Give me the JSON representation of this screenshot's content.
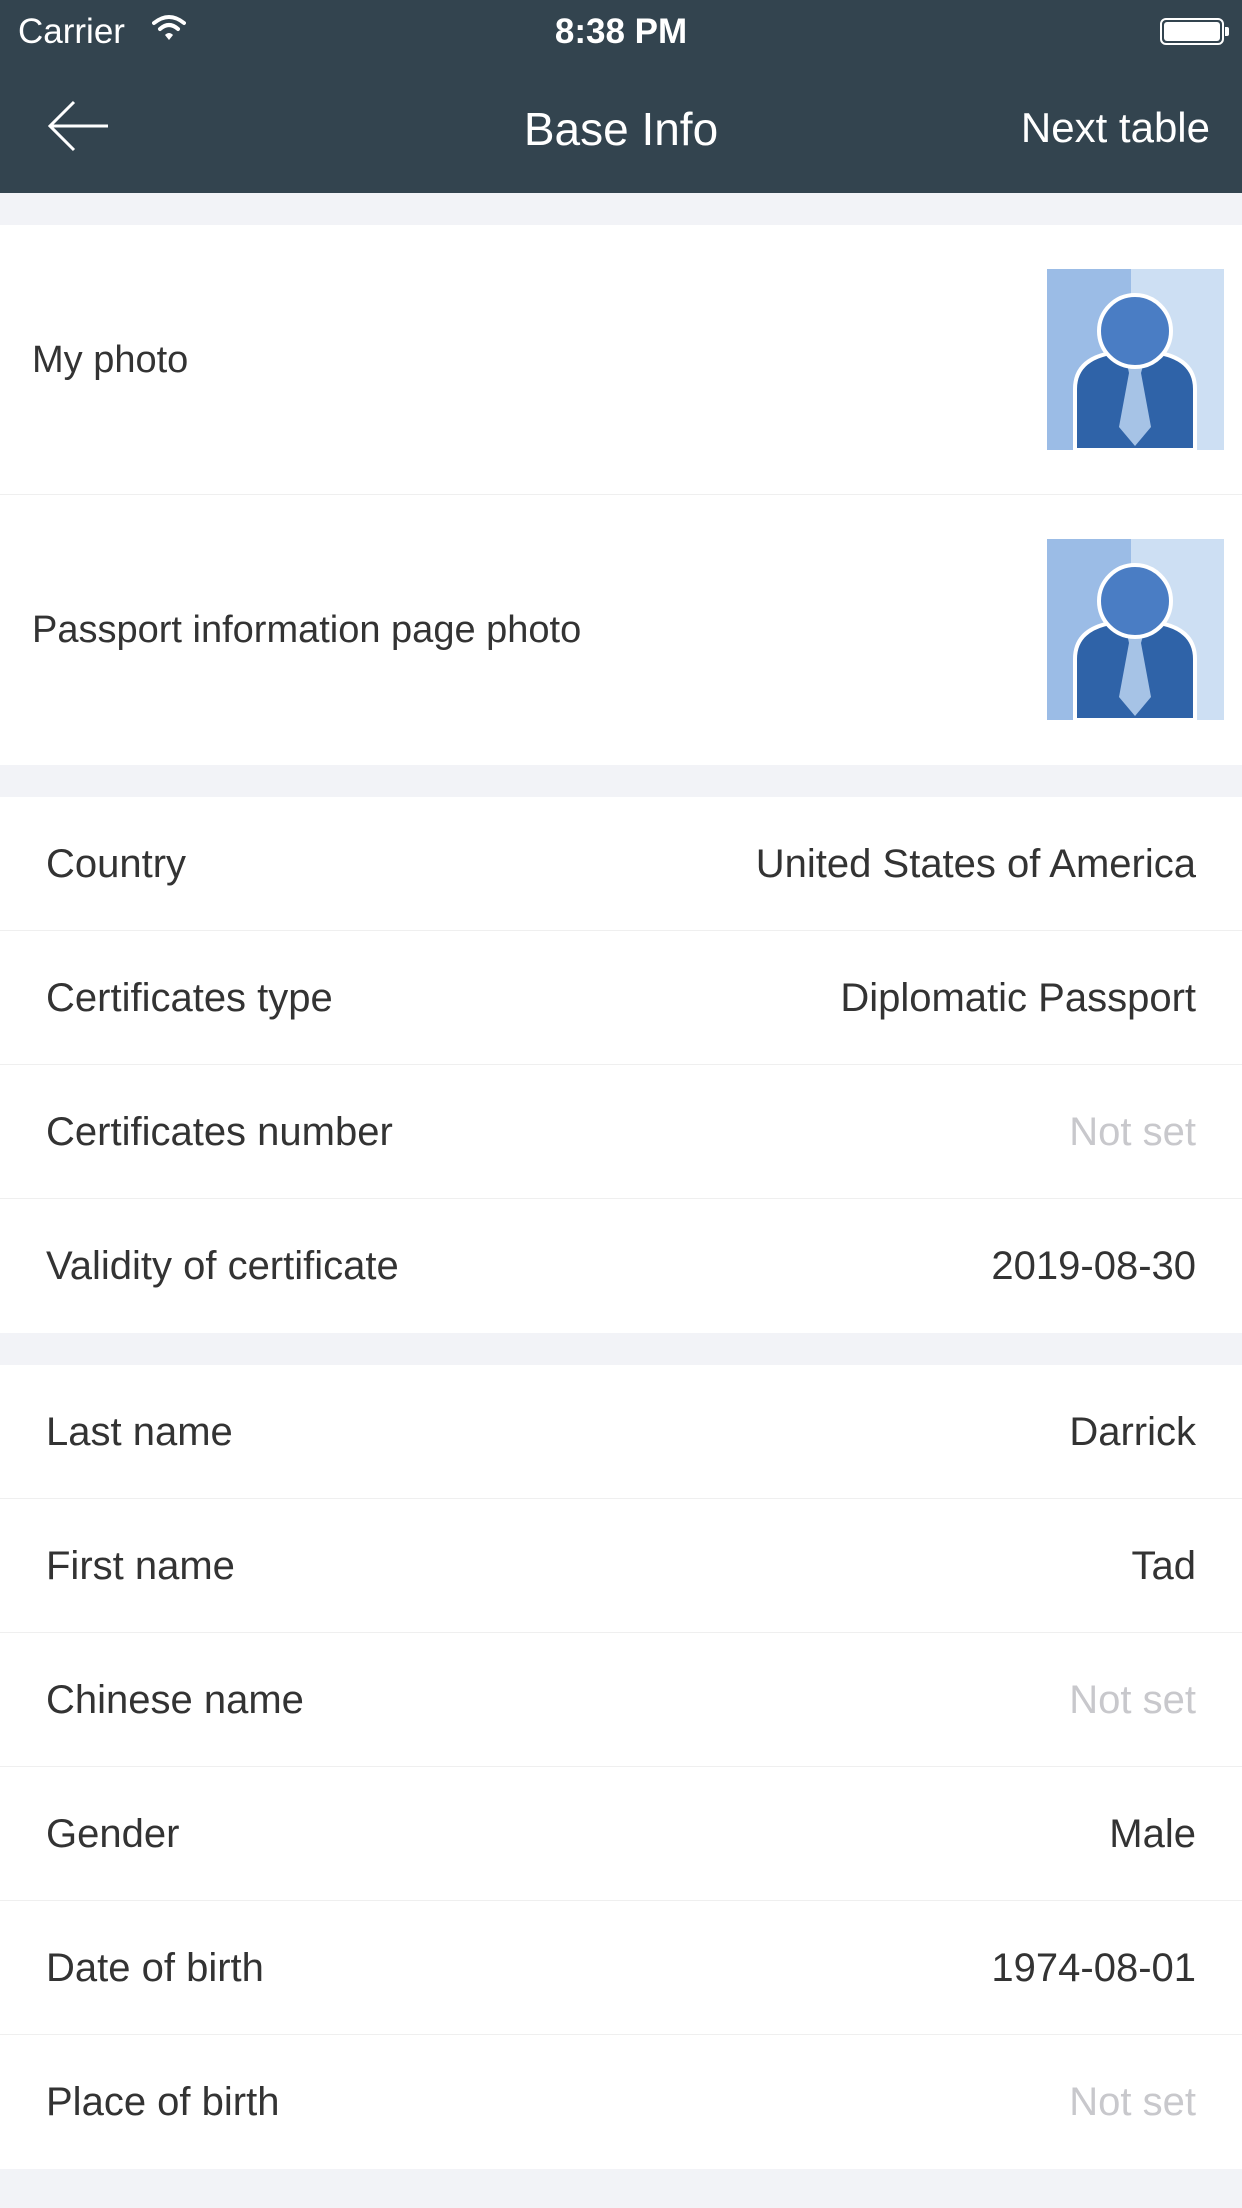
{
  "status_bar": {
    "carrier": "Carrier",
    "time": "8:38 PM"
  },
  "nav": {
    "title": "Base Info",
    "next_label": "Next table"
  },
  "photos": [
    {
      "label": "My photo"
    },
    {
      "label": "Passport information page photo"
    }
  ],
  "certificate": [
    {
      "label": "Country",
      "value": "United States of America"
    },
    {
      "label": "Certificates type",
      "value": "Diplomatic Passport"
    },
    {
      "label": "Certificates number",
      "value": "Not set"
    },
    {
      "label": "Validity of certificate",
      "value": "2019-08-30"
    }
  ],
  "personal": [
    {
      "label": "Last name",
      "value": "Darrick"
    },
    {
      "label": "First name",
      "value": "Tad"
    },
    {
      "label": "Chinese name",
      "value": "Not set"
    },
    {
      "label": "Gender",
      "value": "Male"
    },
    {
      "label": "Date of birth",
      "value": "1974-08-01"
    },
    {
      "label": "Place of birth",
      "value": "Not set"
    }
  ],
  "colors": {
    "header_bg": "#33444f",
    "page_bg": "#f2f3f7",
    "placeholder_text": "#c8c8cc",
    "avatar_blue": "#2f63a8"
  }
}
